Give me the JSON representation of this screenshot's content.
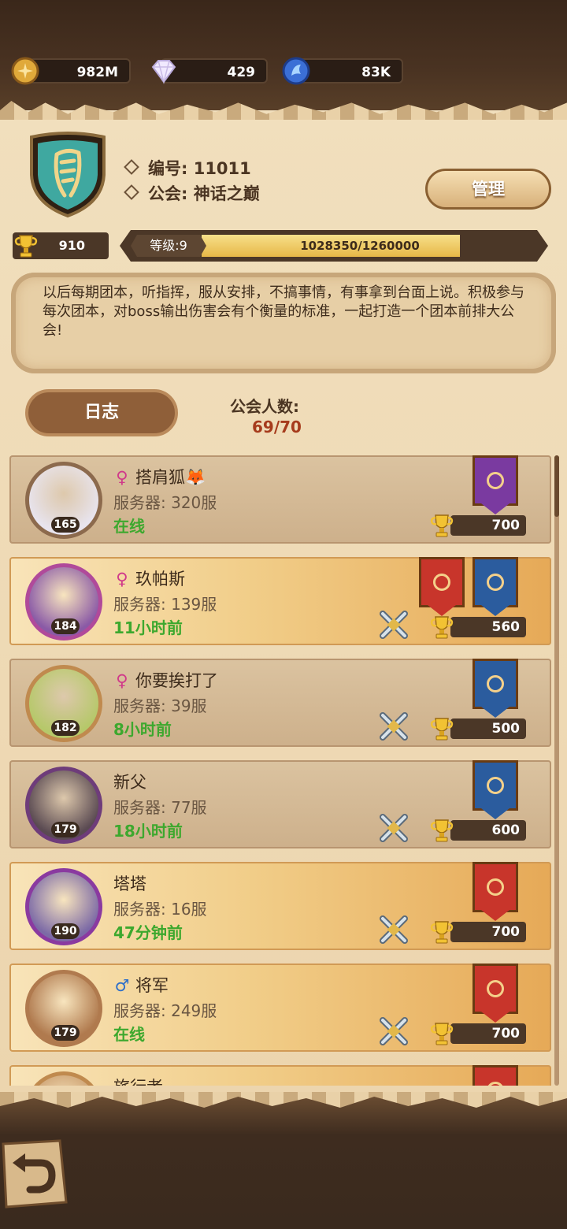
{
  "resources": {
    "gold": "982M",
    "diamonds": "429",
    "crystal": "83K"
  },
  "guild": {
    "id_line": "编号: 11011",
    "name_line": "公会: 神话之巅",
    "manage_label": "管理",
    "trophies": "910",
    "level_label": "等级:9",
    "exp_text": "1028350/1260000",
    "exp_progress": 0.8161,
    "notice": "以后每期团本，听指挥，服从安排，不搞事情，有事拿到台面上说。积极参与每次团本，对boss输出伤害会有个衡量的标准，一起打造一个团本前排大公会!",
    "log_label": "日志",
    "member_count_label": "公会人数:",
    "member_count": "69/70"
  },
  "members": [
    {
      "gender": "♀",
      "name": "搭肩狐🦊",
      "server": "服务器: 320服",
      "status": "在线",
      "level": "165",
      "score": "700",
      "style": "plain",
      "banners": [
        "purple"
      ],
      "swords": false
    },
    {
      "gender": "♀",
      "name": "玖帕斯",
      "server": "服务器: 139服",
      "status": "11小时前",
      "level": "184",
      "score": "560",
      "style": "gold",
      "banners": [
        "red",
        "blue"
      ],
      "swords": true
    },
    {
      "gender": "♀",
      "name": "你要挨打了",
      "server": "服务器: 39服",
      "status": "8小时前",
      "level": "182",
      "score": "500",
      "style": "plain",
      "banners": [
        "blue"
      ],
      "swords": true
    },
    {
      "gender": "",
      "name": "新父",
      "server": "服务器: 77服",
      "status": "18小时前",
      "level": "179",
      "score": "600",
      "style": "plain",
      "banners": [
        "blue"
      ],
      "swords": true
    },
    {
      "gender": "",
      "name": "塔塔",
      "server": "服务器: 16服",
      "status": "47分钟前",
      "level": "190",
      "score": "700",
      "style": "gold",
      "banners": [
        "red"
      ],
      "swords": true
    },
    {
      "gender": "♂",
      "name": "将军",
      "server": "服务器: 249服",
      "status": "在线",
      "level": "179",
      "score": "700",
      "style": "gold",
      "banners": [
        "red"
      ],
      "swords": true
    },
    {
      "gender": "",
      "name": "旅行者",
      "server": "",
      "status": "",
      "level": "",
      "score": "",
      "style": "gold",
      "banners": [
        "red"
      ],
      "swords": false
    }
  ],
  "colors": {
    "online": "#3da82e",
    "female": "#d03a8a",
    "male": "#2e6fc9",
    "count": "#a63b1c"
  }
}
